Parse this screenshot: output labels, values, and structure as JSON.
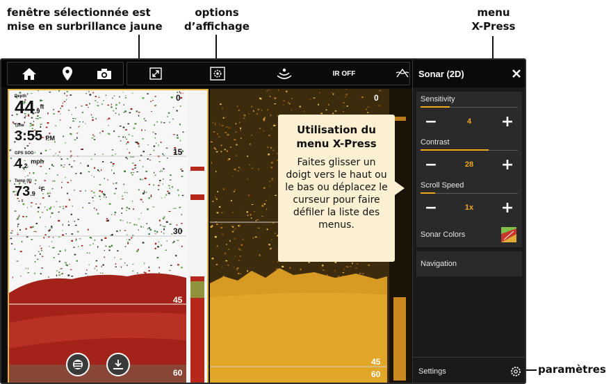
{
  "callouts": {
    "window": {
      "line1": "fenêtre sélectionnée est",
      "line2": "mise en surbrillance jaune"
    },
    "display_options": {
      "line1": "options",
      "line2": "d’affichage"
    },
    "xpress_menu": {
      "line1": "menu",
      "line2": "X-Press"
    },
    "settings": "paramètres"
  },
  "topbar": {
    "icons": [
      "home-icon",
      "waypoint-pin-icon",
      "camera-icon",
      "fullscreen-icon",
      "display-options-gear-icon",
      "sonar-icon",
      "ir-off",
      "water-surface-icon"
    ],
    "ir_label": "IR OFF"
  },
  "left_pane": {
    "readouts": [
      {
        "label": "Depth",
        "value": "44",
        "decimal": ".9",
        "unit": "ft"
      },
      {
        "label": "Time",
        "value": "3:55",
        "decimal": "",
        "unit": "PM"
      },
      {
        "label": "GPS SOG",
        "value": "4",
        "decimal": ".2",
        "unit": "mph"
      },
      {
        "label": "Temp (1)",
        "value": "73",
        "decimal": ".9",
        "unit": "°F"
      }
    ],
    "scale": [
      "0",
      "15",
      "30",
      "45",
      "60"
    ],
    "highlight_color": "#e3b23c",
    "buttons": [
      "layers-icon",
      "download-icon"
    ]
  },
  "mid_pane": {
    "scale": [
      "0",
      "45",
      "60"
    ]
  },
  "tooltip": {
    "title": "Utilisation du menu X-Press",
    "body": "Faites glisser un doigt vers le haut ou le bas ou déplacez le curseur pour faire défiler la liste des menus."
  },
  "xpress": {
    "title": "Sonar (2D)",
    "close_icon": "close-icon",
    "items": [
      {
        "label": "Sensitivity",
        "value": "4",
        "fraction": 0.3
      },
      {
        "label": "Contrast",
        "value": "28",
        "fraction": 0.7
      },
      {
        "label": "Scroll Speed",
        "value": "1x",
        "fraction": 0.15
      }
    ],
    "minus": "−",
    "plus": "+",
    "sonar_colors": "Sonar Colors",
    "navigation": "Navigation",
    "settings": "Settings",
    "accent": "#f2a81d"
  }
}
